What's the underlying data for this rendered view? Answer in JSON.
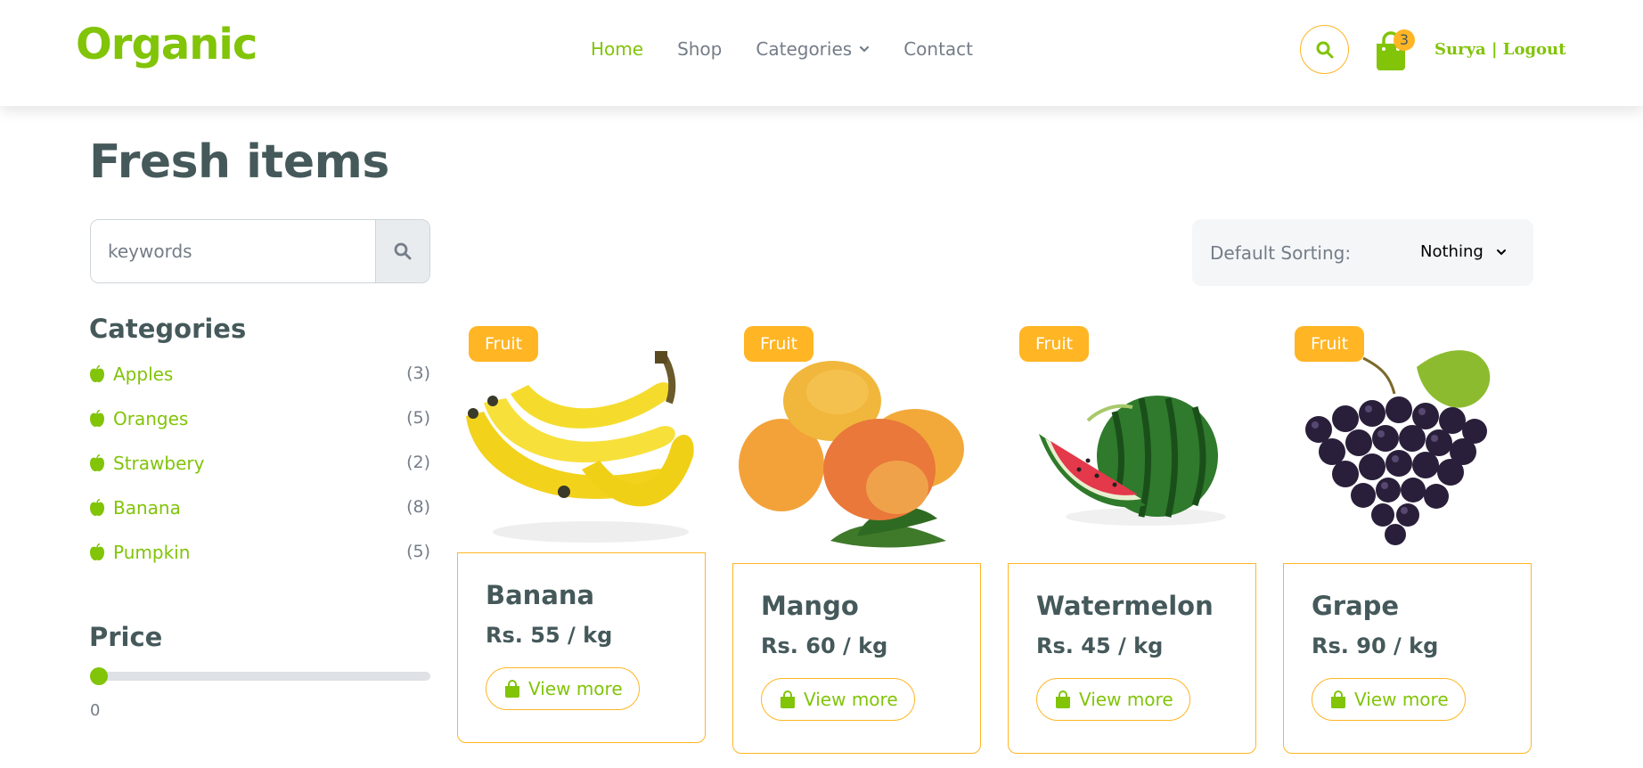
{
  "brand": "Organic",
  "nav": {
    "links": [
      "Home",
      "Shop",
      "Categories",
      "Contact"
    ],
    "cart_count": "3",
    "user_name": "Surya",
    "separator": " | ",
    "logout": "Logout"
  },
  "page_title": "Fresh items",
  "search": {
    "placeholder": "keywords"
  },
  "sort": {
    "label": "Default Sorting:",
    "selected": "Nothing"
  },
  "categories": {
    "title": "Categories",
    "items": [
      {
        "label": "Apples",
        "count": "(3)"
      },
      {
        "label": "Oranges",
        "count": "(5)"
      },
      {
        "label": "Strawbery",
        "count": "(2)"
      },
      {
        "label": "Banana",
        "count": "(8)"
      },
      {
        "label": "Pumpkin",
        "count": "(5)"
      }
    ]
  },
  "price": {
    "title": "Price",
    "value": "0",
    "slider_fraction": 0
  },
  "products": [
    {
      "tag": "Fruit",
      "name": "Banana",
      "price": "Rs. 55 / kg",
      "button": "View more",
      "image": "banana"
    },
    {
      "tag": "Fruit",
      "name": "Mango",
      "price": "Rs. 60 / kg",
      "button": "View more",
      "image": "mango"
    },
    {
      "tag": "Fruit",
      "name": "Watermelon",
      "price": "Rs. 45 / kg",
      "button": "View more",
      "image": "watermelon"
    },
    {
      "tag": "Fruit",
      "name": "Grape",
      "price": "Rs. 90 / kg",
      "button": "View more",
      "image": "grape"
    }
  ],
  "colors": {
    "primary": "#81c408",
    "secondary": "#ffb524",
    "text": "#45595b",
    "muted": "#747d88"
  }
}
